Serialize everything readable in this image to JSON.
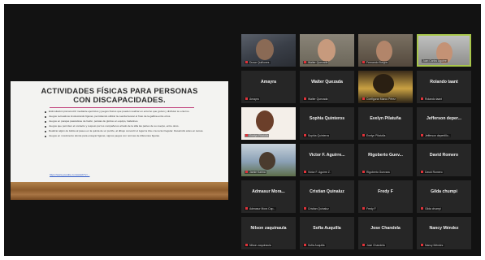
{
  "shared_screen": {
    "slide_title_line1": "ACTIVIDADES FÍSICAS PARA PERSONAS",
    "slide_title_line2": "CON DISCAPACIDADES.",
    "bullets": [
      "Estimulación psicomotriz mediante ejercicios y juegos físicos que pueden realizar en entorno que gozan y disfrutar su entorno.",
      "Juegos recreativos involucrando figuras, permitiendo utilizar la cuerda buscar el fruto de la gallina entre otros.",
      "Juegos en parejas pasándose de balón, pelotas de globos en equipo, bailarines.",
      "Juegos que permiten el contacto y respeto por los compañeros al lado de la silla las partes de su cuerpo, entre otros.",
      "Realizar algún de lúdica al paseo en la quinta de un puzzle, al dibujo convertir el lugar la tiza o la recta irregular. Desarrollo artes en temas.",
      "Juegos en movimiento donde para ensayar figuras, signos juegos con normas de diferentes figuras."
    ],
    "link": "https://www.youtube.com/watch?v=..."
  },
  "participants": [
    {
      "name": "",
      "label": "Duvar Quiñones",
      "muted": true,
      "video": "cap"
    },
    {
      "name": "",
      "label": "Walter Quezada",
      "muted": true,
      "video": "mask"
    },
    {
      "name": "",
      "label": "Fernando Burgos",
      "muted": true,
      "video": "glasses"
    },
    {
      "name": "",
      "label": "Juan Carlos Aguirre",
      "muted": false,
      "video": "man",
      "active": true
    },
    {
      "name": "Amayra",
      "label": "Amayra",
      "muted": true
    },
    {
      "name": "Walter Quezada",
      "label": "Walter Quezada",
      "muted": true
    },
    {
      "name": "",
      "label": "Configurar Marco Pérez",
      "muted": true,
      "video": "photo1"
    },
    {
      "name": "Rolando taant",
      "label": "Rolando taant",
      "muted": true
    },
    {
      "name": "",
      "label": "Evelyn Pilatuña",
      "muted": true,
      "video": "photo2"
    },
    {
      "name": "Sophia Quinteros",
      "label": "Sophia Quinteros",
      "muted": true
    },
    {
      "name": "Evelyn Pilatuña",
      "label": "Evelyn Pilatuña",
      "muted": true
    },
    {
      "name": "Jefferson deper...",
      "label": "Jefferson depertillo...",
      "muted": true
    },
    {
      "name": "",
      "label": "Jamie Karina",
      "muted": true,
      "video": "photo3"
    },
    {
      "name": "Victor F. Aguirre...",
      "label": "Victor F. Aguirre Z.",
      "muted": true
    },
    {
      "name": "Rigoberto Guev...",
      "label": "Rigoberto Guevara",
      "muted": true
    },
    {
      "name": "David Romero",
      "label": "David Romero",
      "muted": true
    },
    {
      "name": "Admasur Mora...",
      "label": "Admasur Mora Cap...",
      "muted": true
    },
    {
      "name": "Cristian Quinaluz",
      "label": "Cristian Quinaluz",
      "muted": true
    },
    {
      "name": "Fredy F",
      "label": "Fredy F",
      "muted": true
    },
    {
      "name": "Gilda chumpi",
      "label": "Gilda chumpi",
      "muted": true
    },
    {
      "name": "Nilson zaquinaula",
      "label": "Nilson zaquinaula",
      "muted": true
    },
    {
      "name": "Sofia Auquilla",
      "label": "Sofia Auquilla",
      "muted": true
    },
    {
      "name": "Jose Chandela",
      "label": "Jose Chandela",
      "muted": true
    },
    {
      "name": "Nancy Méndez",
      "label": "Nancy Méndez",
      "muted": true
    }
  ]
}
